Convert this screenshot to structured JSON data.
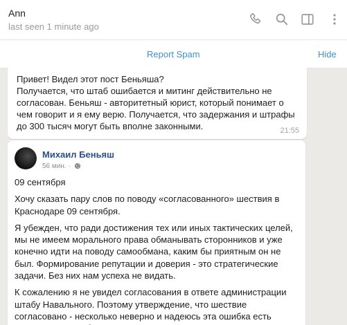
{
  "header": {
    "contact_name": "Ann",
    "status": "last seen 1 minute ago",
    "icons": [
      "phone-icon",
      "search-icon",
      "sidebar-toggle-icon",
      "more-icon"
    ]
  },
  "spam_bar": {
    "report_label": "Report Spam",
    "hide_label": "Hide"
  },
  "message": {
    "text": "Привет! Видел этот пост Беньяша?\nПолучается, что штаб ошибается и митинг действительно не согласован. Беньяш - авторитетный юрист, который понимает о чем говорит и я ему верю. Получается, что задержания и штрафы до 300 тысяч могут быть вполне законными.",
    "time": "21:55"
  },
  "post": {
    "author": "Михаил Беньяш",
    "meta": "56 мин. ·",
    "date": "09 сентября",
    "paragraphs": [
      "Хочу сказать пару слов по поводу «согласованного» шествия в Краснодаре 09 сентября.",
      "Я убежден, что ради достижения тех или иных тактических целей, мы не имеем морального права обманывать сторонников и уже конечно идти на поводу самообмана, каким бы приятным он не был. Формирование репутации и доверия - это стратегические задачи. Без них нам успеха не видать.",
      "К сожалению я не увидел согласования в ответе администрации штабу Навального. Поэтому утверждение, что шествие согласовано - несколько неверно и надеюсь эта ошибка есть следствие самообмана, а не чего то иного."
    ]
  },
  "colors": {
    "accent": "#3f8ed0",
    "author_link": "#2c4f86",
    "chat_background": "#eceae6"
  }
}
